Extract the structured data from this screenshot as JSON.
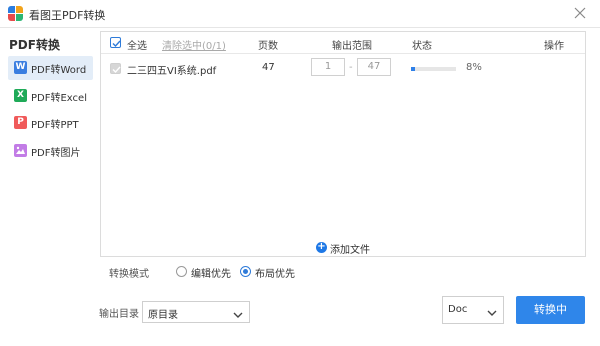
{
  "window": {
    "title": "看图王PDF转换"
  },
  "sidebar": {
    "title": "PDF转换",
    "items": [
      {
        "label": "PDF转Word",
        "icon": "word-icon",
        "icon_letter": "W",
        "color": "#3a7ee0"
      },
      {
        "label": "PDF转Excel",
        "icon": "excel-icon",
        "icon_letter": "X",
        "color": "#1faa58"
      },
      {
        "label": "PDF转PPT",
        "icon": "ppt-icon",
        "icon_letter": "P",
        "color": "#f05a5a"
      },
      {
        "label": "PDF转图片",
        "icon": "image-icon",
        "icon_letter": "",
        "color": "#c27ce6"
      }
    ]
  },
  "table": {
    "select_all": "全选",
    "clear_selected": "清除选中(0/1)",
    "columns": {
      "pages": "页数",
      "range": "输出范围",
      "status": "状态",
      "actions": "操作"
    },
    "rows": [
      {
        "filename": "二三四五VI系统.pdf",
        "pages": "47",
        "range_from": "1",
        "range_sep": "-",
        "range_to": "47",
        "progress": 0.08,
        "progress_text": "8%"
      }
    ],
    "add_file": "添加文件"
  },
  "mode": {
    "label": "转换模式",
    "options": [
      {
        "label": "编辑优先",
        "checked": false
      },
      {
        "label": "布局优先",
        "checked": true
      }
    ]
  },
  "output": {
    "label": "输出目录",
    "directory": "原目录",
    "format": "Doc"
  },
  "convert_button": "转换中",
  "colors": {
    "accent": "#2f86ea",
    "active_item_bg": "#e3edf8"
  }
}
